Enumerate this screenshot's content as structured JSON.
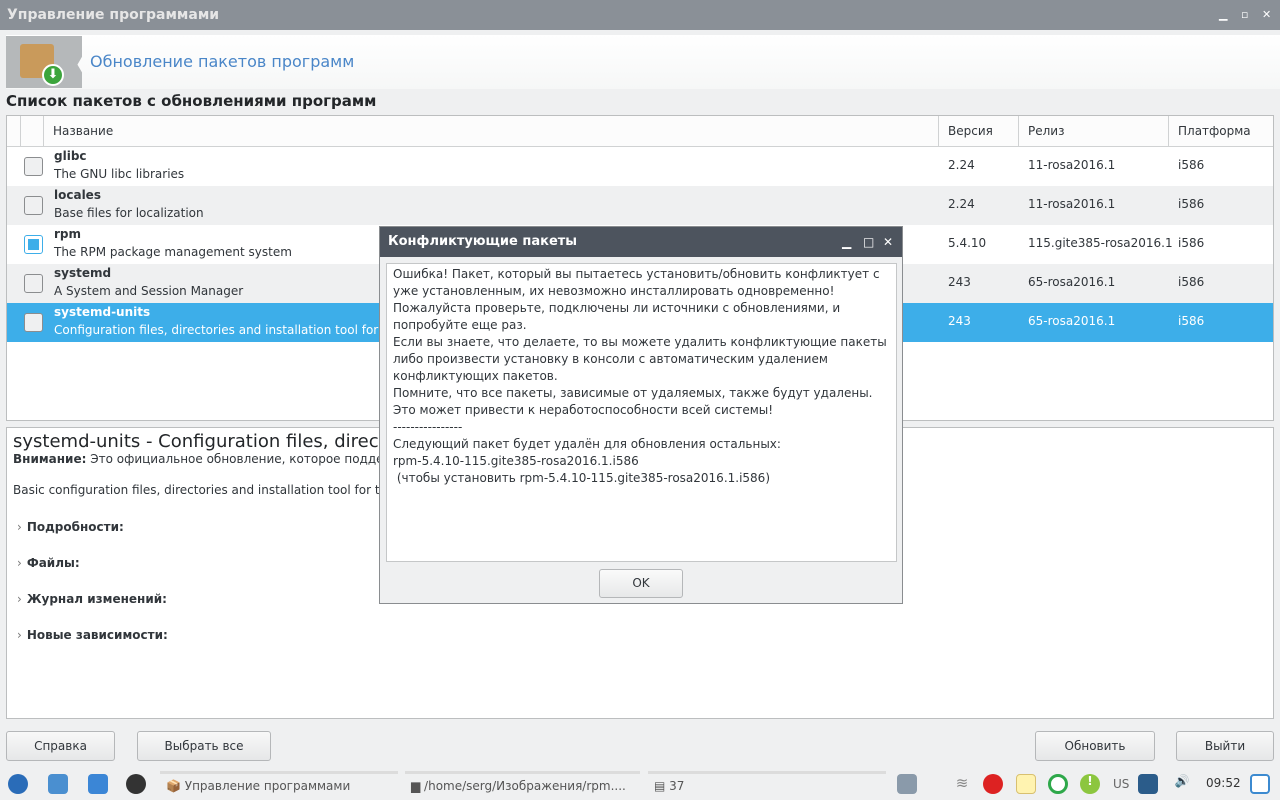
{
  "window": {
    "title": "Управление программами"
  },
  "header": {
    "title": "Обновление пакетов программ"
  },
  "section_title": "Список пакетов с обновлениями программ",
  "table": {
    "columns": [
      "Название",
      "Версия",
      "Релиз",
      "Платформа"
    ],
    "rows": [
      {
        "name": "glibc",
        "desc": "The GNU libc libraries",
        "version": "2.24",
        "release": "11-rosa2016.1",
        "platform": "i586",
        "checked": false
      },
      {
        "name": "locales",
        "desc": "Base files for localization",
        "version": "2.24",
        "release": "11-rosa2016.1",
        "platform": "i586",
        "checked": false
      },
      {
        "name": "rpm",
        "desc": "The RPM package management system",
        "version": "5.4.10",
        "release": "115.gite385-rosa2016.1",
        "platform": "i586",
        "checked": true
      },
      {
        "name": "systemd",
        "desc": "A System and Session Manager",
        "version": "243",
        "release": "65-rosa2016.1",
        "platform": "i586",
        "checked": false
      },
      {
        "name": "systemd-units",
        "desc": "Configuration files, directories and installation tool for systemd",
        "version": "243",
        "release": "65-rosa2016.1",
        "platform": "i586",
        "checked": false,
        "selected": true
      }
    ]
  },
  "detail": {
    "title": "systemd-units - Configuration files, directories and installation tool for systemd",
    "warning_label": "Внимание:",
    "warning_text": " Это официальное обновление, которое поддерживается ROSA.",
    "description": "Basic configuration files, directories and installation tool for the systemd system and service manager.",
    "sections": [
      "Подробности:",
      "Файлы:",
      "Журнал изменений:",
      "Новые зависимости:"
    ]
  },
  "buttons": {
    "help": "Справка",
    "select_all": "Выбрать все",
    "update": "Обновить",
    "quit": "Выйти"
  },
  "dialog": {
    "title": "Конфликтующие пакеты",
    "text": "Ошибка! Пакет, который вы пытаетесь установить/обновить конфликтует с уже установленным, их невозможно инсталлировать одновременно!\nПожалуйста проверьте, подключены ли источники с обновлениями, и попробуйте еще раз.\nЕсли вы знаете, что делаете, то вы можете удалить конфликтующие пакеты либо произвести установку в консоли с автоматическим удалением конфликтующих пакетов.\nПомните, что все пакеты, зависимые от удаляемых, также будут удалены. Это может привести к неработоспособности всей системы!\n----------------\nСледующий пакет будет удалён для обновления остальных:\nrpm-5.4.10-115.gite385-rosa2016.1.i586\n (чтобы установить rpm-5.4.10-115.gite385-rosa2016.1.i586)",
    "ok": "OK"
  },
  "taskbar": {
    "tasks": [
      "Управление программами",
      "/home/serg/Изображения/rpm....",
      "37"
    ],
    "keyboard_layout": "US",
    "clock": "09:52"
  },
  "colors": {
    "accent": "#3daee9",
    "titlebar": "#8a9097",
    "dialog_header": "#4d545e"
  }
}
